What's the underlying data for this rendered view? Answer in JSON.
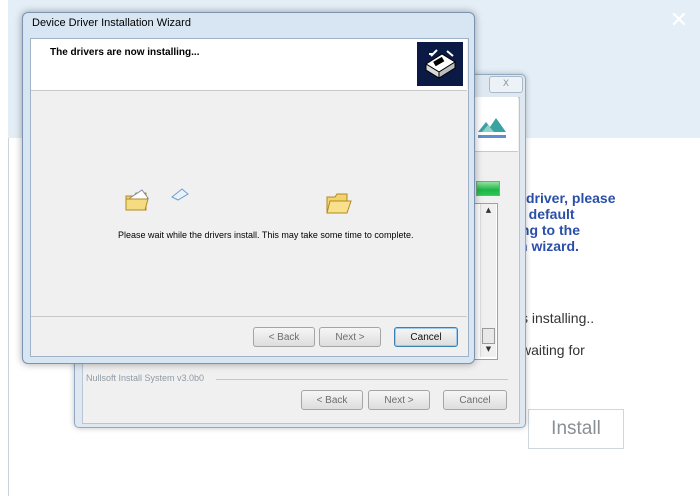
{
  "background_app": {
    "close_glyph": "✕",
    "partial_text_lines": [
      "driver, please",
      "e default",
      "ing to the",
      "n wizard."
    ],
    "status_line_1": "s installing..",
    "status_line_2": "waiting for",
    "install_button": "Install"
  },
  "installer": {
    "close_glyph": "X",
    "branding": "Nullsoft Install System v3.0b0",
    "back_button": "< Back",
    "next_button": "Next >",
    "cancel_button": "Cancel",
    "scroll_up": "▲",
    "scroll_down": "▼"
  },
  "wizard": {
    "title": "Device Driver Installation Wizard",
    "heading": "The drivers are now installing...",
    "message": "Please wait while the drivers install. This may take some time to complete.",
    "back_button": "< Back",
    "next_button": "Next >",
    "cancel_button": "Cancel"
  },
  "colors": {
    "accent_blue_text": "#2a4fa8",
    "progress_green": "#1fb546",
    "focus_border": "#3c7fb1"
  }
}
